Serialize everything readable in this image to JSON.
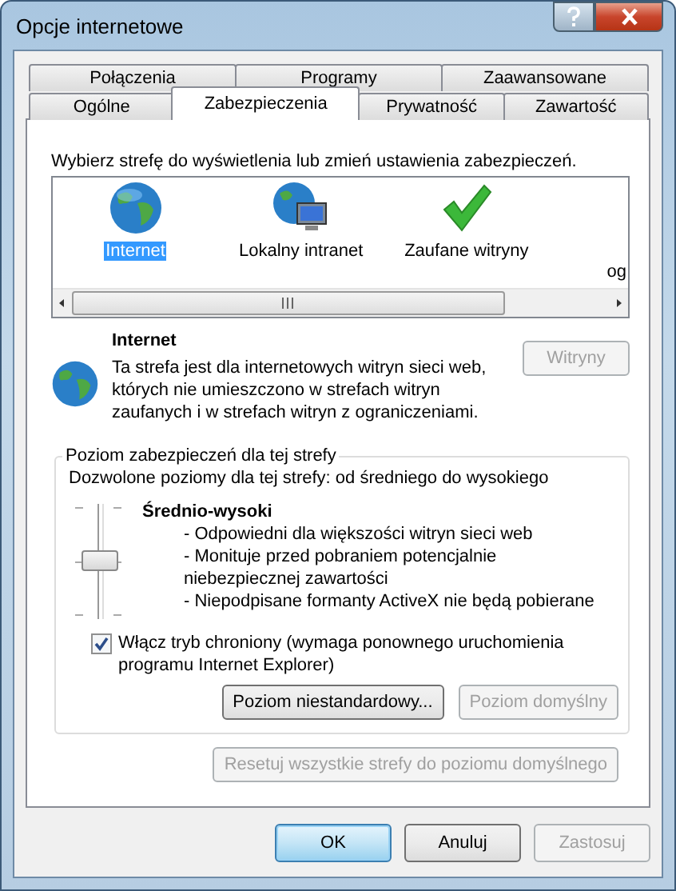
{
  "window": {
    "title": "Opcje internetowe"
  },
  "tab_rows": [
    [
      {
        "label": "Połączenia",
        "selected": false
      },
      {
        "label": "Programy",
        "selected": false
      },
      {
        "label": "Zaawansowane",
        "selected": false
      }
    ],
    [
      {
        "label": "Ogólne",
        "selected": false
      },
      {
        "label": "Zabezpieczenia",
        "selected": true
      },
      {
        "label": "Prywatność",
        "selected": false
      },
      {
        "label": "Zawartość",
        "selected": false
      }
    ]
  ],
  "instruction": "Wybierz strefę do wyświetlenia lub zmień ustawienia zabezpieczeń.",
  "zones": [
    {
      "label": "Internet",
      "kind": "globe",
      "selected": true
    },
    {
      "label": "Lokalny intranet",
      "kind": "intranet",
      "selected": false
    },
    {
      "label": "Zaufane witryny",
      "kind": "check",
      "selected": false
    },
    {
      "label": "og",
      "kind": "partial",
      "selected": false
    }
  ],
  "zone_info": {
    "title": "Internet",
    "description": "Ta strefa jest dla internetowych witryn sieci web, których nie umieszczono w strefach witryn zaufanych i w strefach witryn z ograniczeniami.",
    "sites_button": {
      "label": "Witryny",
      "disabled": true
    }
  },
  "security_level": {
    "group_title": "Poziom zabezpieczeń dla tej strefy",
    "allowed": "Dozwolone poziomy dla tej strefy: od średniego do wysokiego",
    "slider": {
      "level": 0.5
    },
    "level_name": "Średnio-wysoki",
    "bullets": [
      "- Odpowiedni dla większości witryn sieci web",
      "- Monituje przed pobraniem potencjalnie niebezpiecznej zawartości",
      "- Niepodpisane formanty ActiveX nie będą pobierane"
    ],
    "protected_mode": {
      "label": "Włącz tryb chroniony (wymaga ponownego uruchomienia programu Internet Explorer)",
      "checked": true
    },
    "buttons": [
      {
        "label": "Poziom niestandardowy...",
        "disabled": false
      },
      {
        "label": "Poziom domyślny",
        "disabled": true
      }
    ]
  },
  "reset_button": {
    "label": "Resetuj wszystkie strefy do poziomu domyślnego",
    "disabled": true
  },
  "dialog_buttons": [
    {
      "label": "OK",
      "disabled": false,
      "default": true
    },
    {
      "label": "Anuluj",
      "disabled": false,
      "default": false
    },
    {
      "label": "Zastosuj",
      "disabled": true,
      "default": false
    }
  ]
}
